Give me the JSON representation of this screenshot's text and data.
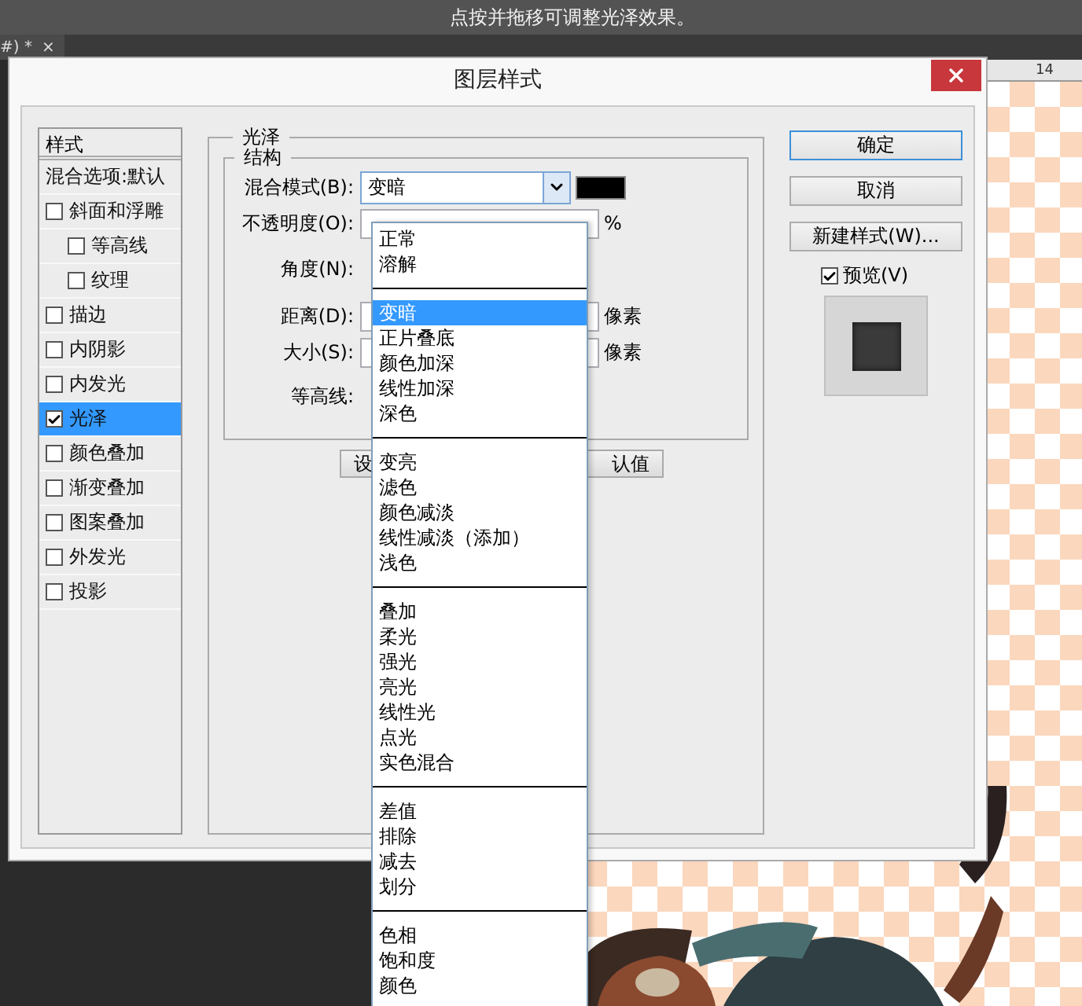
{
  "caption": "点按并拖移可调整光泽效果。",
  "document_tab": {
    "label": "#) *",
    "close": "×"
  },
  "ruler": {
    "mark": "14"
  },
  "dialog": {
    "title": "图层样式",
    "styles": {
      "header": "样式",
      "blending_options": "混合选项:默认",
      "items": [
        {
          "label": "斜面和浮雕",
          "checked": false,
          "selected": false,
          "children": [
            {
              "label": "等高线",
              "checked": false,
              "selected": false
            },
            {
              "label": "纹理",
              "checked": false,
              "selected": false
            }
          ]
        },
        {
          "label": "描边",
          "checked": false,
          "selected": false
        },
        {
          "label": "内阴影",
          "checked": false,
          "selected": false
        },
        {
          "label": "内发光",
          "checked": false,
          "selected": false
        },
        {
          "label": "光泽",
          "checked": true,
          "selected": true
        },
        {
          "label": "颜色叠加",
          "checked": false,
          "selected": false
        },
        {
          "label": "渐变叠加",
          "checked": false,
          "selected": false
        },
        {
          "label": "图案叠加",
          "checked": false,
          "selected": false
        },
        {
          "label": "外发光",
          "checked": false,
          "selected": false
        },
        {
          "label": "投影",
          "checked": false,
          "selected": false
        }
      ]
    },
    "section": {
      "title": "光泽",
      "group": "结构",
      "blend_mode": {
        "label": "混合模式(B):",
        "value": "变暗",
        "color": "#000000"
      },
      "opacity": {
        "label": "不透明度(O):",
        "unit": "%"
      },
      "angle": {
        "label": "角度(N):"
      },
      "distance": {
        "label": "距离(D):",
        "unit": "像素"
      },
      "size": {
        "label": "大小(S):",
        "unit": "像素"
      },
      "contour": {
        "label": "等高线:"
      },
      "buttons": [
        "设",
        "认值"
      ]
    },
    "actions": [
      {
        "label": "确定",
        "default": true
      },
      {
        "label": "取消",
        "default": false
      },
      {
        "label": "新建样式(W)...",
        "default": false
      }
    ],
    "preview": {
      "label": "预览(V)",
      "checked": true
    }
  },
  "blend_menu": {
    "groups": [
      {
        "items": [
          {
            "label": "正常",
            "selected": false
          },
          {
            "label": "溶解",
            "selected": false
          }
        ]
      },
      {
        "items": [
          {
            "label": "变暗",
            "selected": true
          },
          {
            "label": "正片叠底",
            "selected": false
          },
          {
            "label": "颜色加深",
            "selected": false
          },
          {
            "label": "线性加深",
            "selected": false
          },
          {
            "label": "深色",
            "selected": false
          }
        ]
      },
      {
        "items": [
          {
            "label": "变亮",
            "selected": false
          },
          {
            "label": "滤色",
            "selected": false
          },
          {
            "label": "颜色减淡",
            "selected": false
          },
          {
            "label": "线性减淡（添加）",
            "selected": false
          },
          {
            "label": "浅色",
            "selected": false
          }
        ]
      },
      {
        "items": [
          {
            "label": "叠加",
            "selected": false
          },
          {
            "label": "柔光",
            "selected": false
          },
          {
            "label": "强光",
            "selected": false
          },
          {
            "label": "亮光",
            "selected": false
          },
          {
            "label": "线性光",
            "selected": false
          },
          {
            "label": "点光",
            "selected": false
          },
          {
            "label": "实色混合",
            "selected": false
          }
        ]
      },
      {
        "items": [
          {
            "label": "差值",
            "selected": false
          },
          {
            "label": "排除",
            "selected": false
          },
          {
            "label": "减去",
            "selected": false
          },
          {
            "label": "划分",
            "selected": false
          }
        ]
      },
      {
        "items": [
          {
            "label": "色相",
            "selected": false
          },
          {
            "label": "饱和度",
            "selected": false
          },
          {
            "label": "颜色",
            "selected": false
          }
        ]
      }
    ]
  }
}
